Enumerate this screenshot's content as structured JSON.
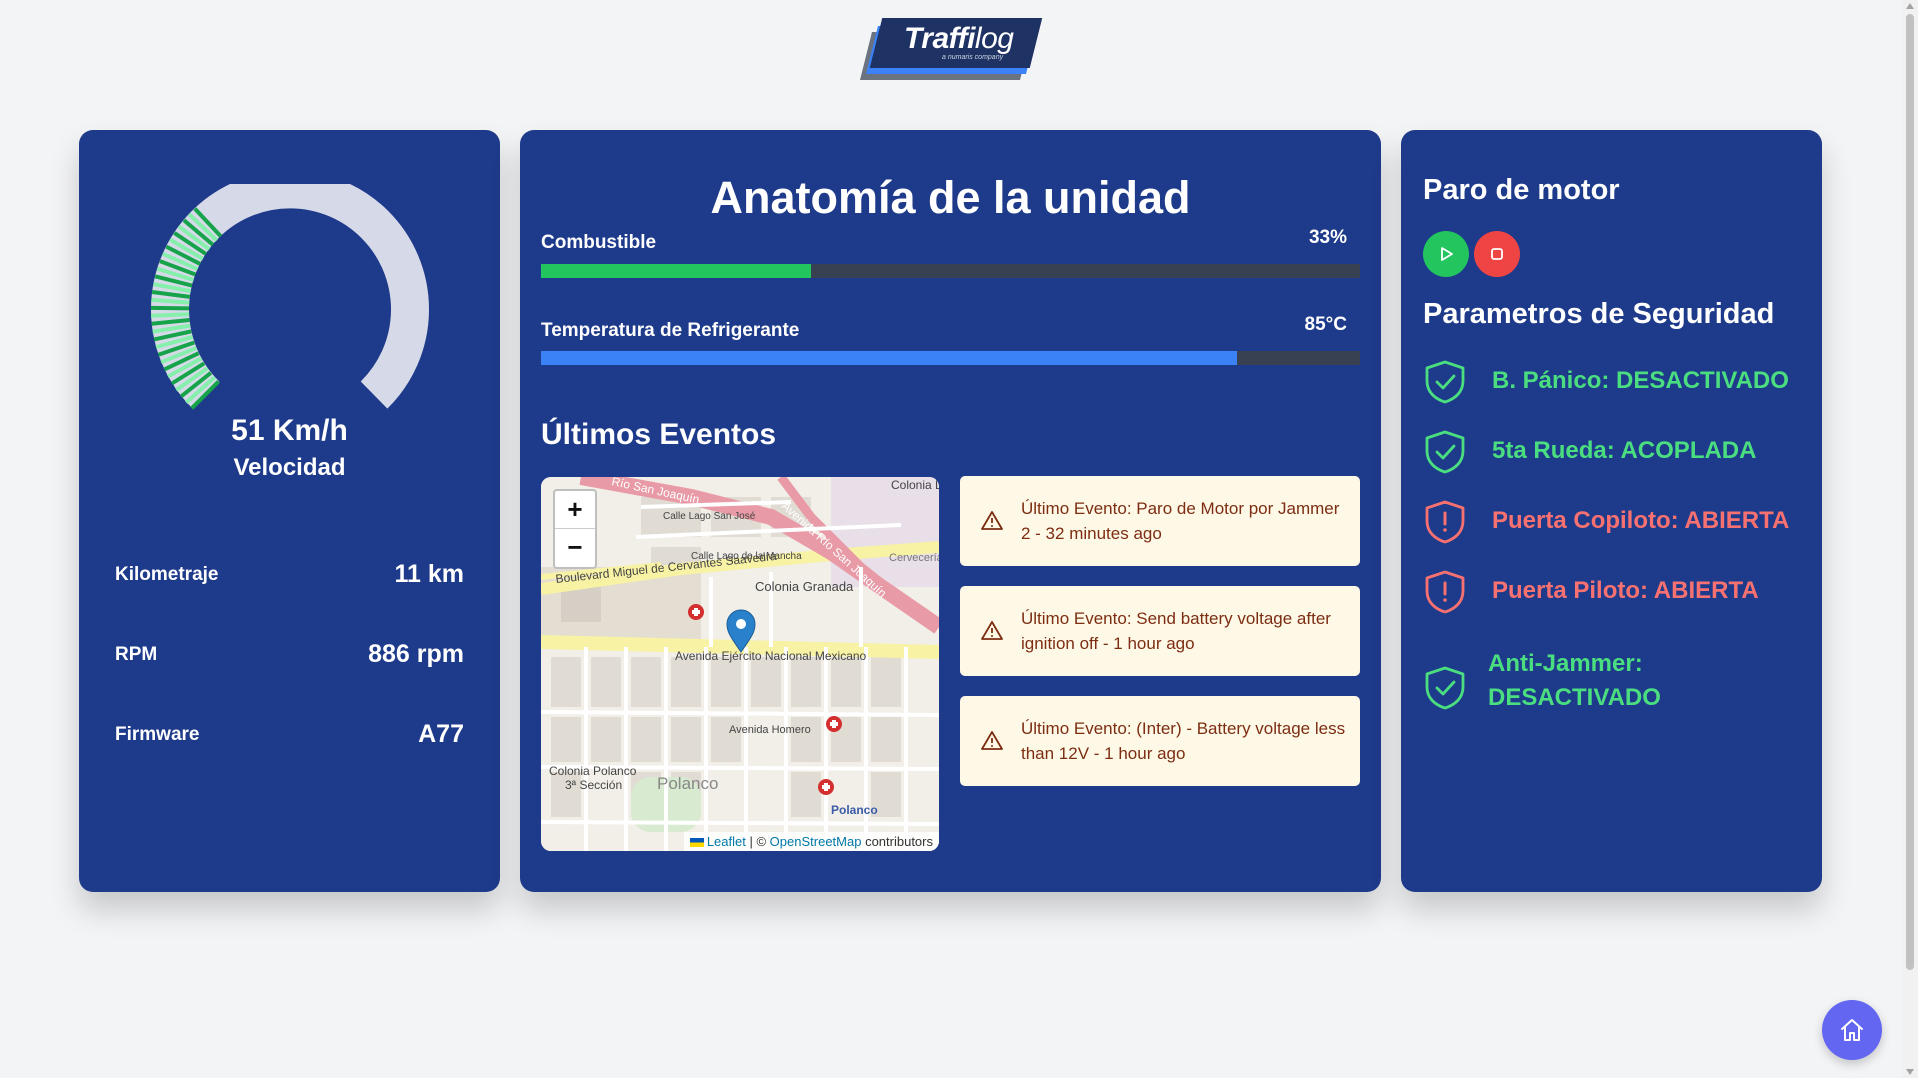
{
  "logo": {
    "brand_bold": "Traffi",
    "brand_light": "log",
    "tagline": "a numaris company"
  },
  "vehicle": {
    "speed_value": "51 Km/h",
    "speed_label": "Velocidad",
    "speed_fraction": 0.34,
    "stats": [
      {
        "label": "Kilometraje",
        "value": "11 km"
      },
      {
        "label": "RPM",
        "value": "886 rpm"
      },
      {
        "label": "Firmware",
        "value": "A77"
      }
    ]
  },
  "anatomy": {
    "title": "Anatomía de la unidad",
    "fuel": {
      "label": "Combustible",
      "value": "33%",
      "percent": 33
    },
    "coolant": {
      "label": "Temperatura de Refrigerante",
      "value": "85°C",
      "percent": 85
    }
  },
  "events": {
    "title": "Últimos Eventos",
    "items": [
      "Último Evento: Paro de Motor por Jammer 2 - 32 minutes ago",
      "Último Evento: Send battery voltage after ignition off - 1 hour ago",
      "Último Evento: (Inter) - Battery voltage less than 12V - 1 hour ago"
    ]
  },
  "map": {
    "zoom_in": "+",
    "zoom_out": "−",
    "attribution_leaflet": "Leaflet",
    "attribution_sep": " | © ",
    "attribution_osm": "OpenStreetMap",
    "attribution_tail": " contributors",
    "labels": {
      "colonia_lagos": "Colonia Lagos",
      "calle_lago_sanjose": "Calle Lago San José",
      "calle_lago_mancha": "Calle Lago de la Mancha",
      "cerveceria": "Cervecería Modelo",
      "boulevard": "Boulevard Miguel de Cervantes Saavedra",
      "colonia_granada": "Colonia Granada",
      "avenida_ejercito": "Avenida Ejército Nacional Mexicano",
      "avenida_homero": "Avenida Homero",
      "colonia_polanco": "Colonia Polanco",
      "tercera_seccion": "3ª Sección",
      "polanco": "Polanco",
      "polanco_station": "Polanco",
      "rio_sanjoaquin": "Río San Joaquín",
      "avenida_rio_sanjoaquin": "Avenida Río San Joaquín"
    }
  },
  "engine": {
    "title": "Paro de motor",
    "start_icon": "play-icon",
    "stop_icon": "stop-icon"
  },
  "security": {
    "title": "Parametros de Seguridad",
    "items": [
      {
        "text": "B. Pánico: DESACTIVADO",
        "status": "ok",
        "icon": "shield-check-icon"
      },
      {
        "text": "5ta Rueda: ACOPLADA",
        "status": "ok",
        "icon": "shield-check-icon"
      },
      {
        "text": "Puerta Copiloto: ABIERTA",
        "status": "alert",
        "icon": "shield-alert-icon"
      },
      {
        "text": "Puerta Piloto: ABIERTA",
        "status": "alert",
        "icon": "shield-alert-icon"
      },
      {
        "text_line1": "Anti-Jammer:",
        "text_line2": "DESACTIVADO",
        "status": "ok",
        "icon": "shield-check-icon"
      }
    ]
  },
  "colors": {
    "card": "#1e3a8a",
    "fuel_bar": "#22c55e",
    "coolant_bar": "#3b82f6",
    "ok": "#4ade80",
    "alert": "#f87171",
    "start": "#22c55e",
    "stop": "#ef4444",
    "home": "#6366f1",
    "event_bg": "#fef9e7",
    "event_text": "#7c2d12"
  },
  "home_icon": "home-icon"
}
